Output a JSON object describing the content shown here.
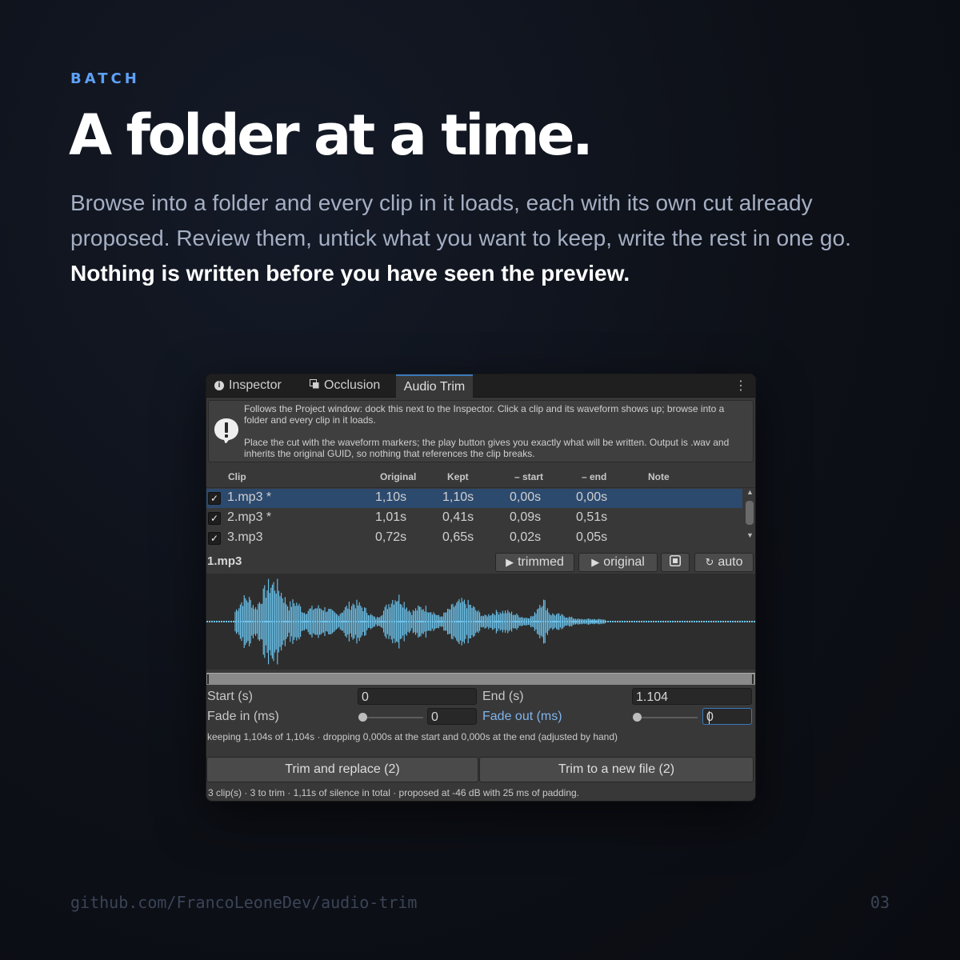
{
  "eyebrow": "BATCH",
  "headline": "A folder at a time.",
  "lede": {
    "text": "Browse into a folder and every clip in it loads, each with its own cut already proposed. Review them, untick what you want to keep, write the rest in one go.",
    "emphasis": "Nothing is written before you have seen the preview."
  },
  "footer": {
    "url": "github.com/FrancoLeoneDev/audio-trim",
    "page": "03"
  },
  "window": {
    "tabs": [
      {
        "label": "Inspector",
        "icon": "info-icon"
      },
      {
        "label": "Occlusion",
        "icon": "occlusion-icon"
      },
      {
        "label": "Audio Trim",
        "icon": ""
      }
    ],
    "active_tab": "Audio Trim",
    "menu_icon": "kebab-menu-icon",
    "help": {
      "icon": "warning-speech-icon",
      "line1": "Follows the Project window: dock this next to the Inspector. Click a clip and its waveform shows up; browse into a folder and every clip in it loads.",
      "line2": "Place the cut with the waveform markers; the play button gives you exactly what will be written. Output is .wav and inherits the original GUID, so nothing that references the clip breaks."
    },
    "table": {
      "headers": [
        "Clip",
        "Original",
        "Kept",
        "– start",
        "– end",
        "Note"
      ],
      "rows": [
        {
          "checked": true,
          "clip": "1.mp3 *",
          "original": "1,10s",
          "kept": "1,10s",
          "start": "0,00s",
          "end": "0,00s",
          "note": ""
        },
        {
          "checked": true,
          "clip": "2.mp3 *",
          "original": "1,01s",
          "kept": "0,41s",
          "start": "0,09s",
          "end": "0,51s",
          "note": ""
        },
        {
          "checked": true,
          "clip": "3.mp3",
          "original": "0,72s",
          "kept": "0,65s",
          "start": "0,02s",
          "end": "0,05s",
          "note": ""
        }
      ],
      "selected_row": 0
    },
    "clip_title": "1.mp3",
    "play_buttons": {
      "trimmed": "trimmed",
      "original": "original",
      "stop_icon": "stop-icon",
      "auto": "auto"
    },
    "colors": {
      "waveform": "#6ec6f0",
      "accent": "#3a79bb",
      "selection": "#2c4a6e",
      "fade_out_label": "#7fb4ec"
    },
    "fields": {
      "start_label": "Start (s)",
      "start_value": "0",
      "end_label": "End (s)",
      "end_value": "1.104",
      "fade_in_label": "Fade in (ms)",
      "fade_in_value": "0",
      "fade_out_label": "Fade out (ms)",
      "fade_out_value": "0"
    },
    "keeping_text": "keeping 1,104s of 1,104s · dropping 0,000s at the start and 0,000s at the end  (adjusted by hand)",
    "buttons": {
      "replace": "Trim and replace (2)",
      "new_file": "Trim to a new file (2)"
    },
    "summary": "3 clip(s) · 3 to trim · 1,11s of silence in total · proposed at -46 dB with 25 ms of padding."
  }
}
